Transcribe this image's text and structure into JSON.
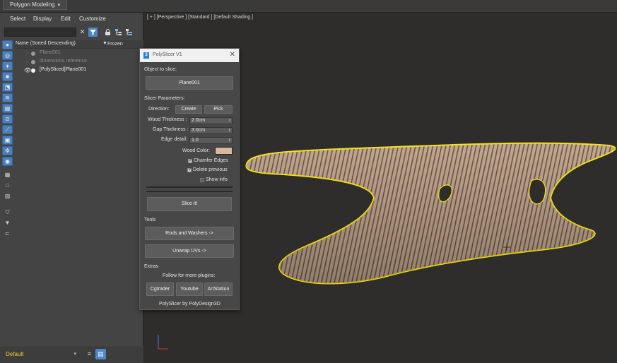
{
  "ribbon": {
    "tab_label": "Polygon Modeling",
    "tab_arrow": "▾"
  },
  "explorer": {
    "menu": [
      "Select",
      "Display",
      "Edit",
      "Customize"
    ],
    "search": {
      "value": "",
      "placeholder": ""
    },
    "header": {
      "name_col": "Name (Sorted Descending)",
      "frozen_col": "Frozen"
    },
    "items": [
      {
        "label": "Plane001",
        "state": "dim"
      },
      {
        "label": "dimensions reference",
        "state": "dim"
      },
      {
        "label": "[PolySliced]Plane001",
        "state": "active"
      }
    ],
    "layer": {
      "value": "Default"
    }
  },
  "viewport": {
    "label": "[ + ] [Perspective ] [Standard ] [Default Shading ]"
  },
  "dialog": {
    "title": "PolySlicer V1",
    "object_label": "Object to slice:",
    "object_button": "Plane001",
    "params_label": "Slicer Parameters:",
    "direction_label": "Direction:",
    "create_button": "Create",
    "pick_button": "Pick",
    "wood_thickness_label": "Wood Thickness :",
    "wood_thickness_value": "2.0cm",
    "gap_thickness_label": "Gap Thickness :",
    "gap_thickness_value": "3.0cm",
    "edge_detail_label": "Edge detail:",
    "edge_detail_value": "1.0",
    "wood_color_label": "Wood Color:",
    "wood_color_hex": "#d9b8a0",
    "chamfer_label": "Chamfer Edges",
    "chamfer_checked": true,
    "delete_prev_label": "Delete previous",
    "delete_prev_checked": true,
    "show_info_label": "Show info",
    "show_info_checked": false,
    "slice_button": "Slice it!",
    "tools_label": "Tools",
    "rods_button": "Rods and Washers     ->",
    "unwrap_button": "Unwrap UVs           ->",
    "extras_label": "Extras",
    "follow_label": "Follow for more plugins:",
    "cgtrader_button": "Cgtrader",
    "youtube_button": "Youtube",
    "artstation_button": "ArtStation",
    "footer": "PolySlicer by PolyDesign3D"
  },
  "colors": {
    "accent_blue": "#4f86c5",
    "selection_outline": "#f3e21a",
    "wood": "#c6ab95",
    "layer_text": "#f0d32e"
  }
}
